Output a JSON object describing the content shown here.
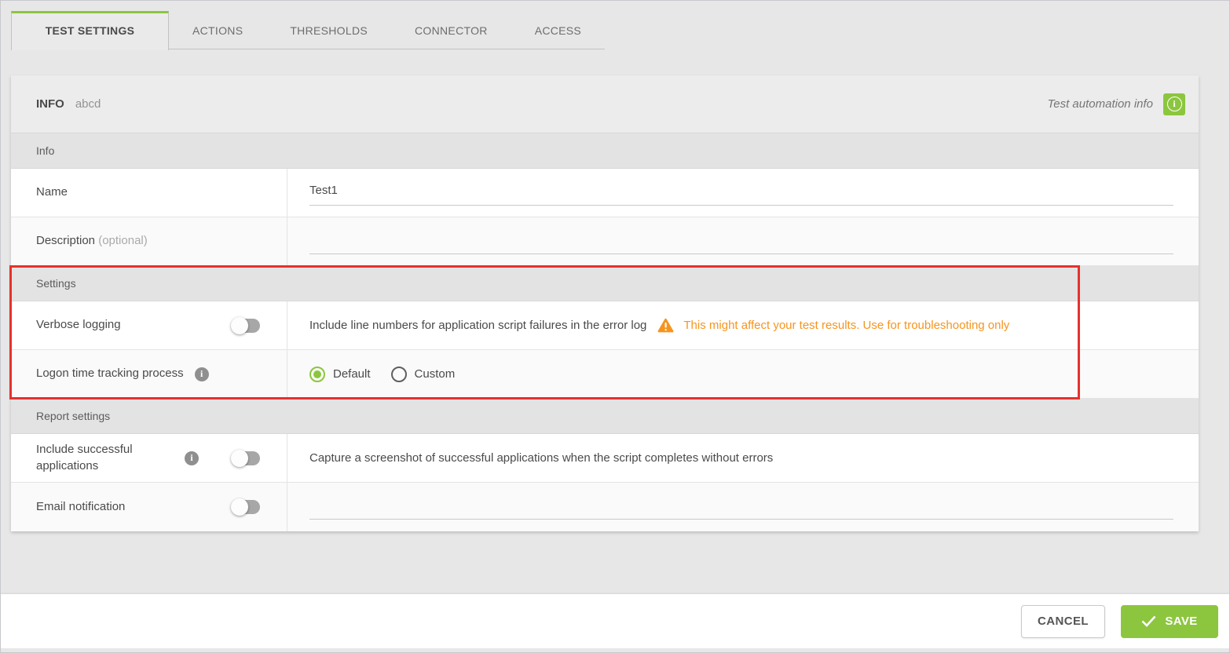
{
  "tabs": {
    "items": [
      {
        "label": "TEST SETTINGS",
        "active": true
      },
      {
        "label": "ACTIONS",
        "active": false
      },
      {
        "label": "THRESHOLDS",
        "active": false
      },
      {
        "label": "CONNECTOR",
        "active": false
      },
      {
        "label": "ACCESS",
        "active": false
      }
    ]
  },
  "info_header": {
    "title": "INFO",
    "name": "abcd",
    "right_label": "Test automation info",
    "info_icon": "info-icon"
  },
  "sections": {
    "info": {
      "header": "Info",
      "name_row": {
        "label": "Name",
        "value": "Test1"
      },
      "description_row": {
        "label": "Description",
        "optional": "(optional)",
        "value": ""
      }
    },
    "settings": {
      "header": "Settings",
      "verbose_row": {
        "label": "Verbose logging",
        "toggle_state": "off",
        "description": "Include line numbers for application script failures in the error log",
        "warning_icon": "warning-icon",
        "warning": "This might affect your test results. Use for troubleshooting only"
      },
      "logon_row": {
        "label": "Logon time tracking process",
        "info_icon": "info-icon",
        "options": [
          {
            "label": "Default",
            "selected": true
          },
          {
            "label": "Custom",
            "selected": false
          }
        ]
      }
    },
    "report": {
      "header": "Report settings",
      "include_row": {
        "label": "Include successful applications",
        "info_icon": "info-icon",
        "toggle_state": "off",
        "description": "Capture a screenshot of successful applications when the script completes without errors"
      },
      "email_row": {
        "label": "Email notification",
        "toggle_state": "off",
        "value": ""
      }
    }
  },
  "highlight": {
    "type": "red-annotation-box",
    "color": "#e6312e"
  },
  "footer": {
    "cancel_label": "CANCEL",
    "save_label": "SAVE"
  },
  "colors": {
    "accent_green": "#8cc63f",
    "warning_orange": "#f7941d",
    "highlight_red": "#e6312e"
  }
}
